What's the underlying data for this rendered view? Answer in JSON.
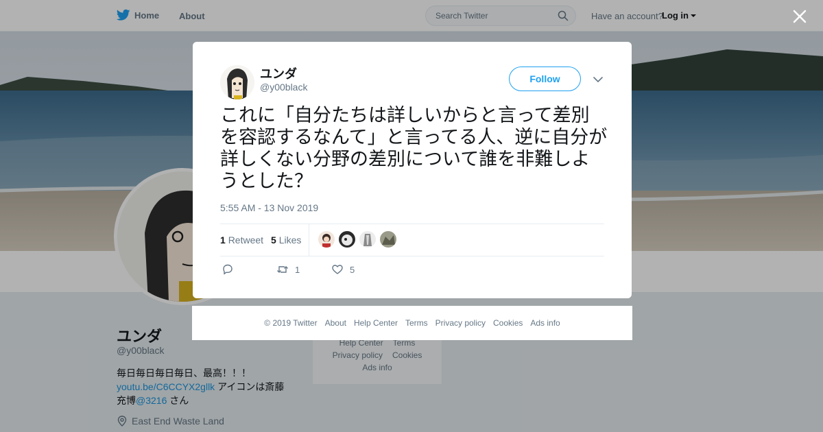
{
  "topbar": {
    "home_label": "Home",
    "about_label": "About",
    "search_placeholder": "Search Twitter",
    "have_account": "Have an account?",
    "login_label": "Log in"
  },
  "profile": {
    "name": "ユンダ",
    "handle": "@y00black",
    "bio_line1": "毎日毎日毎日毎日、最高！！！",
    "bio_link": "youtu.be/C6CCYX2gllk",
    "bio_line2_rest": " アイコンは斎藤",
    "bio_line3_prefix": "充博",
    "bio_mention": "@3216",
    "bio_line3_suffix": " さん",
    "location": "East End Waste Land"
  },
  "sidebar_footer": {
    "items_row1": [
      "Help Center",
      "Terms"
    ],
    "items_row2": [
      "Privacy policy",
      "Cookies"
    ],
    "items_row3": [
      "Ads info"
    ]
  },
  "tweet": {
    "author_name": "ユンダ",
    "author_handle": "@y00black",
    "follow_label": "Follow",
    "text": "これに「自分たちは詳しいからと言って差別を容認するなんて」と言ってる人、逆に自分が詳しくない分野の差別について誰を非難しようとした？",
    "timestamp": "5:55 AM - 13 Nov 2019",
    "retweet_count": "1",
    "retweet_label": "Retweet",
    "likes_count": "5",
    "likes_label": "Likes",
    "action_retweet_count": "1",
    "action_like_count": "5"
  },
  "modal_footer": {
    "copyright": "© 2019 Twitter",
    "about": "About",
    "help_center": "Help Center",
    "terms": "Terms",
    "privacy": "Privacy policy",
    "cookies": "Cookies",
    "ads_info": "Ads info"
  },
  "colors": {
    "accent": "#1da1f2",
    "link": "#1b95e0",
    "muted": "#657786"
  }
}
